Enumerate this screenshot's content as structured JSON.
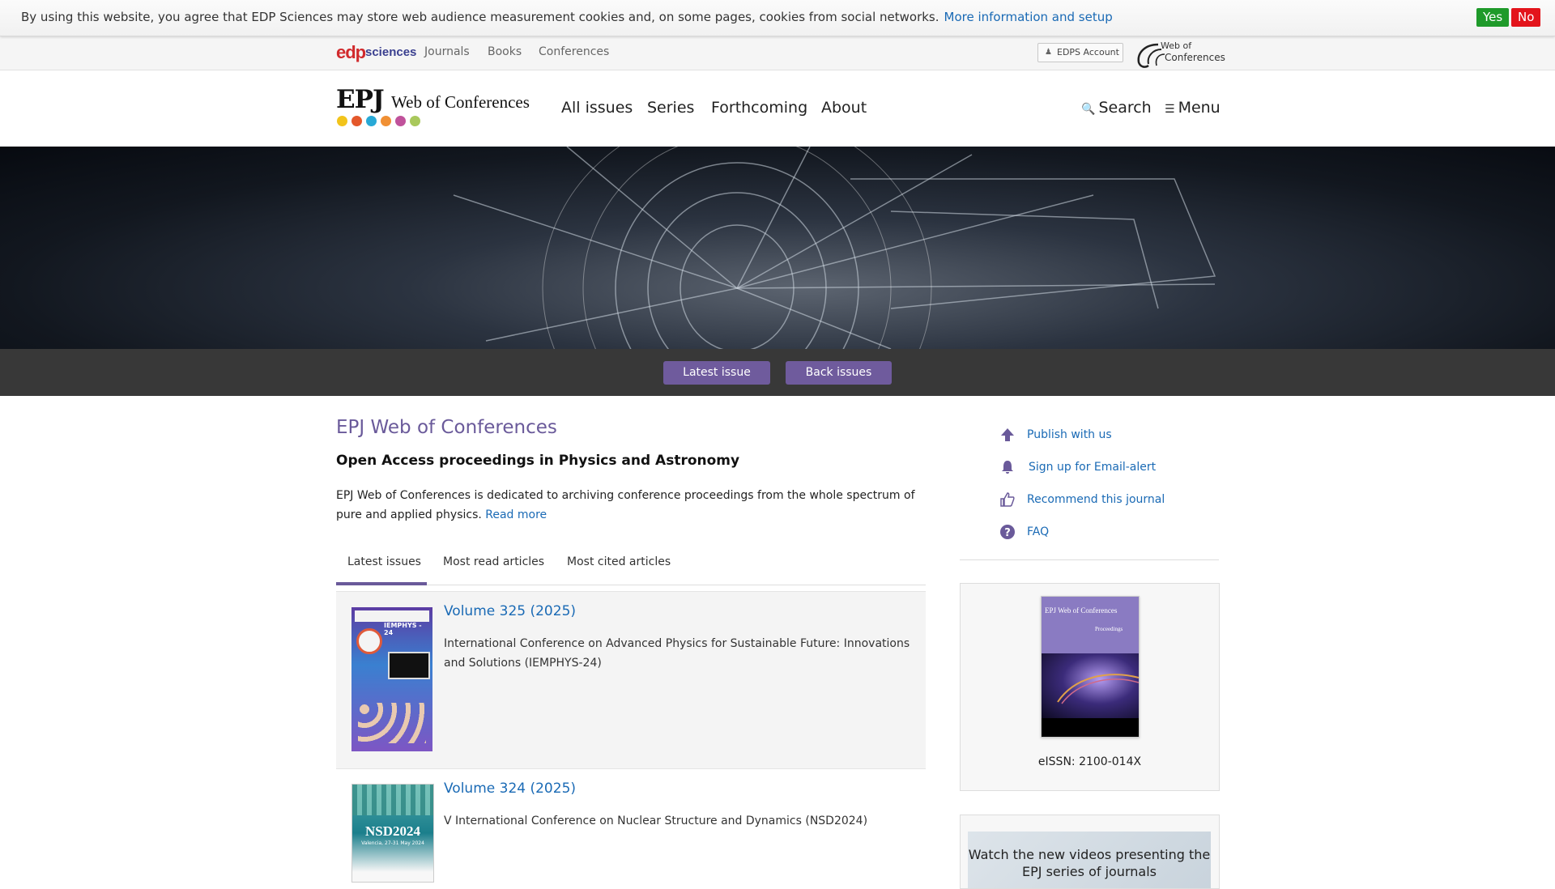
{
  "cookie": {
    "text": "By using this website, you agree that EDP Sciences may store web audience measurement cookies and, on some pages, cookies from social networks.",
    "link": "More information and setup",
    "yes": "Yes",
    "no": "No",
    "yes_color": "#1f9a2a",
    "no_color": "#e3141b"
  },
  "publisher": {
    "logo_mark": "edp",
    "logo_text": "sciences",
    "links": [
      "Journals",
      "Books",
      "Conferences"
    ],
    "account": "EDPS Account",
    "woc_line1": "Web of",
    "woc_line2": "Conferences"
  },
  "journal_logo": {
    "abbr": "EPJ",
    "name": "Web of Conferences",
    "dot_colors": [
      "#f2c41b",
      "#e4582b",
      "#28a9d6",
      "#f09034",
      "#c0529b",
      "#a9c85c"
    ]
  },
  "nav": {
    "items": [
      "All issues",
      "Series",
      "Forthcoming",
      "About"
    ],
    "search": "Search",
    "menu": "Menu"
  },
  "issue_buttons": {
    "latest": "Latest issue",
    "back": "Back issues"
  },
  "main": {
    "title": "EPJ Web of Conferences",
    "subtitle": "Open Access proceedings in Physics and Astronomy",
    "description": "EPJ Web of Conferences is dedicated to archiving conference proceedings from the whole spectrum of pure and applied physics.",
    "read_more": "Read more",
    "accent_color": "#6a5a9a"
  },
  "tabs": [
    "Latest issues",
    "Most read articles",
    "Most cited articles"
  ],
  "volumes": [
    {
      "title": "Volume 325 (2025)",
      "description": "International Conference on Advanced Physics for Sustainable Future: Innovations and Solutions (IEMPHYS-24)",
      "cover_label": "IEMPHYS - 24"
    },
    {
      "title": "Volume 324 (2025)",
      "description": "V International Conference on Nuclear Structure and Dynamics (NSD2024)",
      "cover_label": "NSD2024",
      "cover_sub": "Valencia, 27-31 May 2024"
    }
  ],
  "sidebar": {
    "links": [
      {
        "label": "Publish with us",
        "icon": "upload-arrow-icon"
      },
      {
        "label": "Sign up for Email-alert",
        "icon": "bell-icon"
      },
      {
        "label": "Recommend this journal",
        "icon": "thumbs-up-icon"
      },
      {
        "label": "FAQ",
        "icon": "question-icon"
      }
    ],
    "cover_top": "EPJ Web of Conferences",
    "cover_sub": "Proceedings",
    "issn": "eISSN: 2100-014X",
    "video_text": "Watch the new videos presenting the EPJ series of journals"
  }
}
